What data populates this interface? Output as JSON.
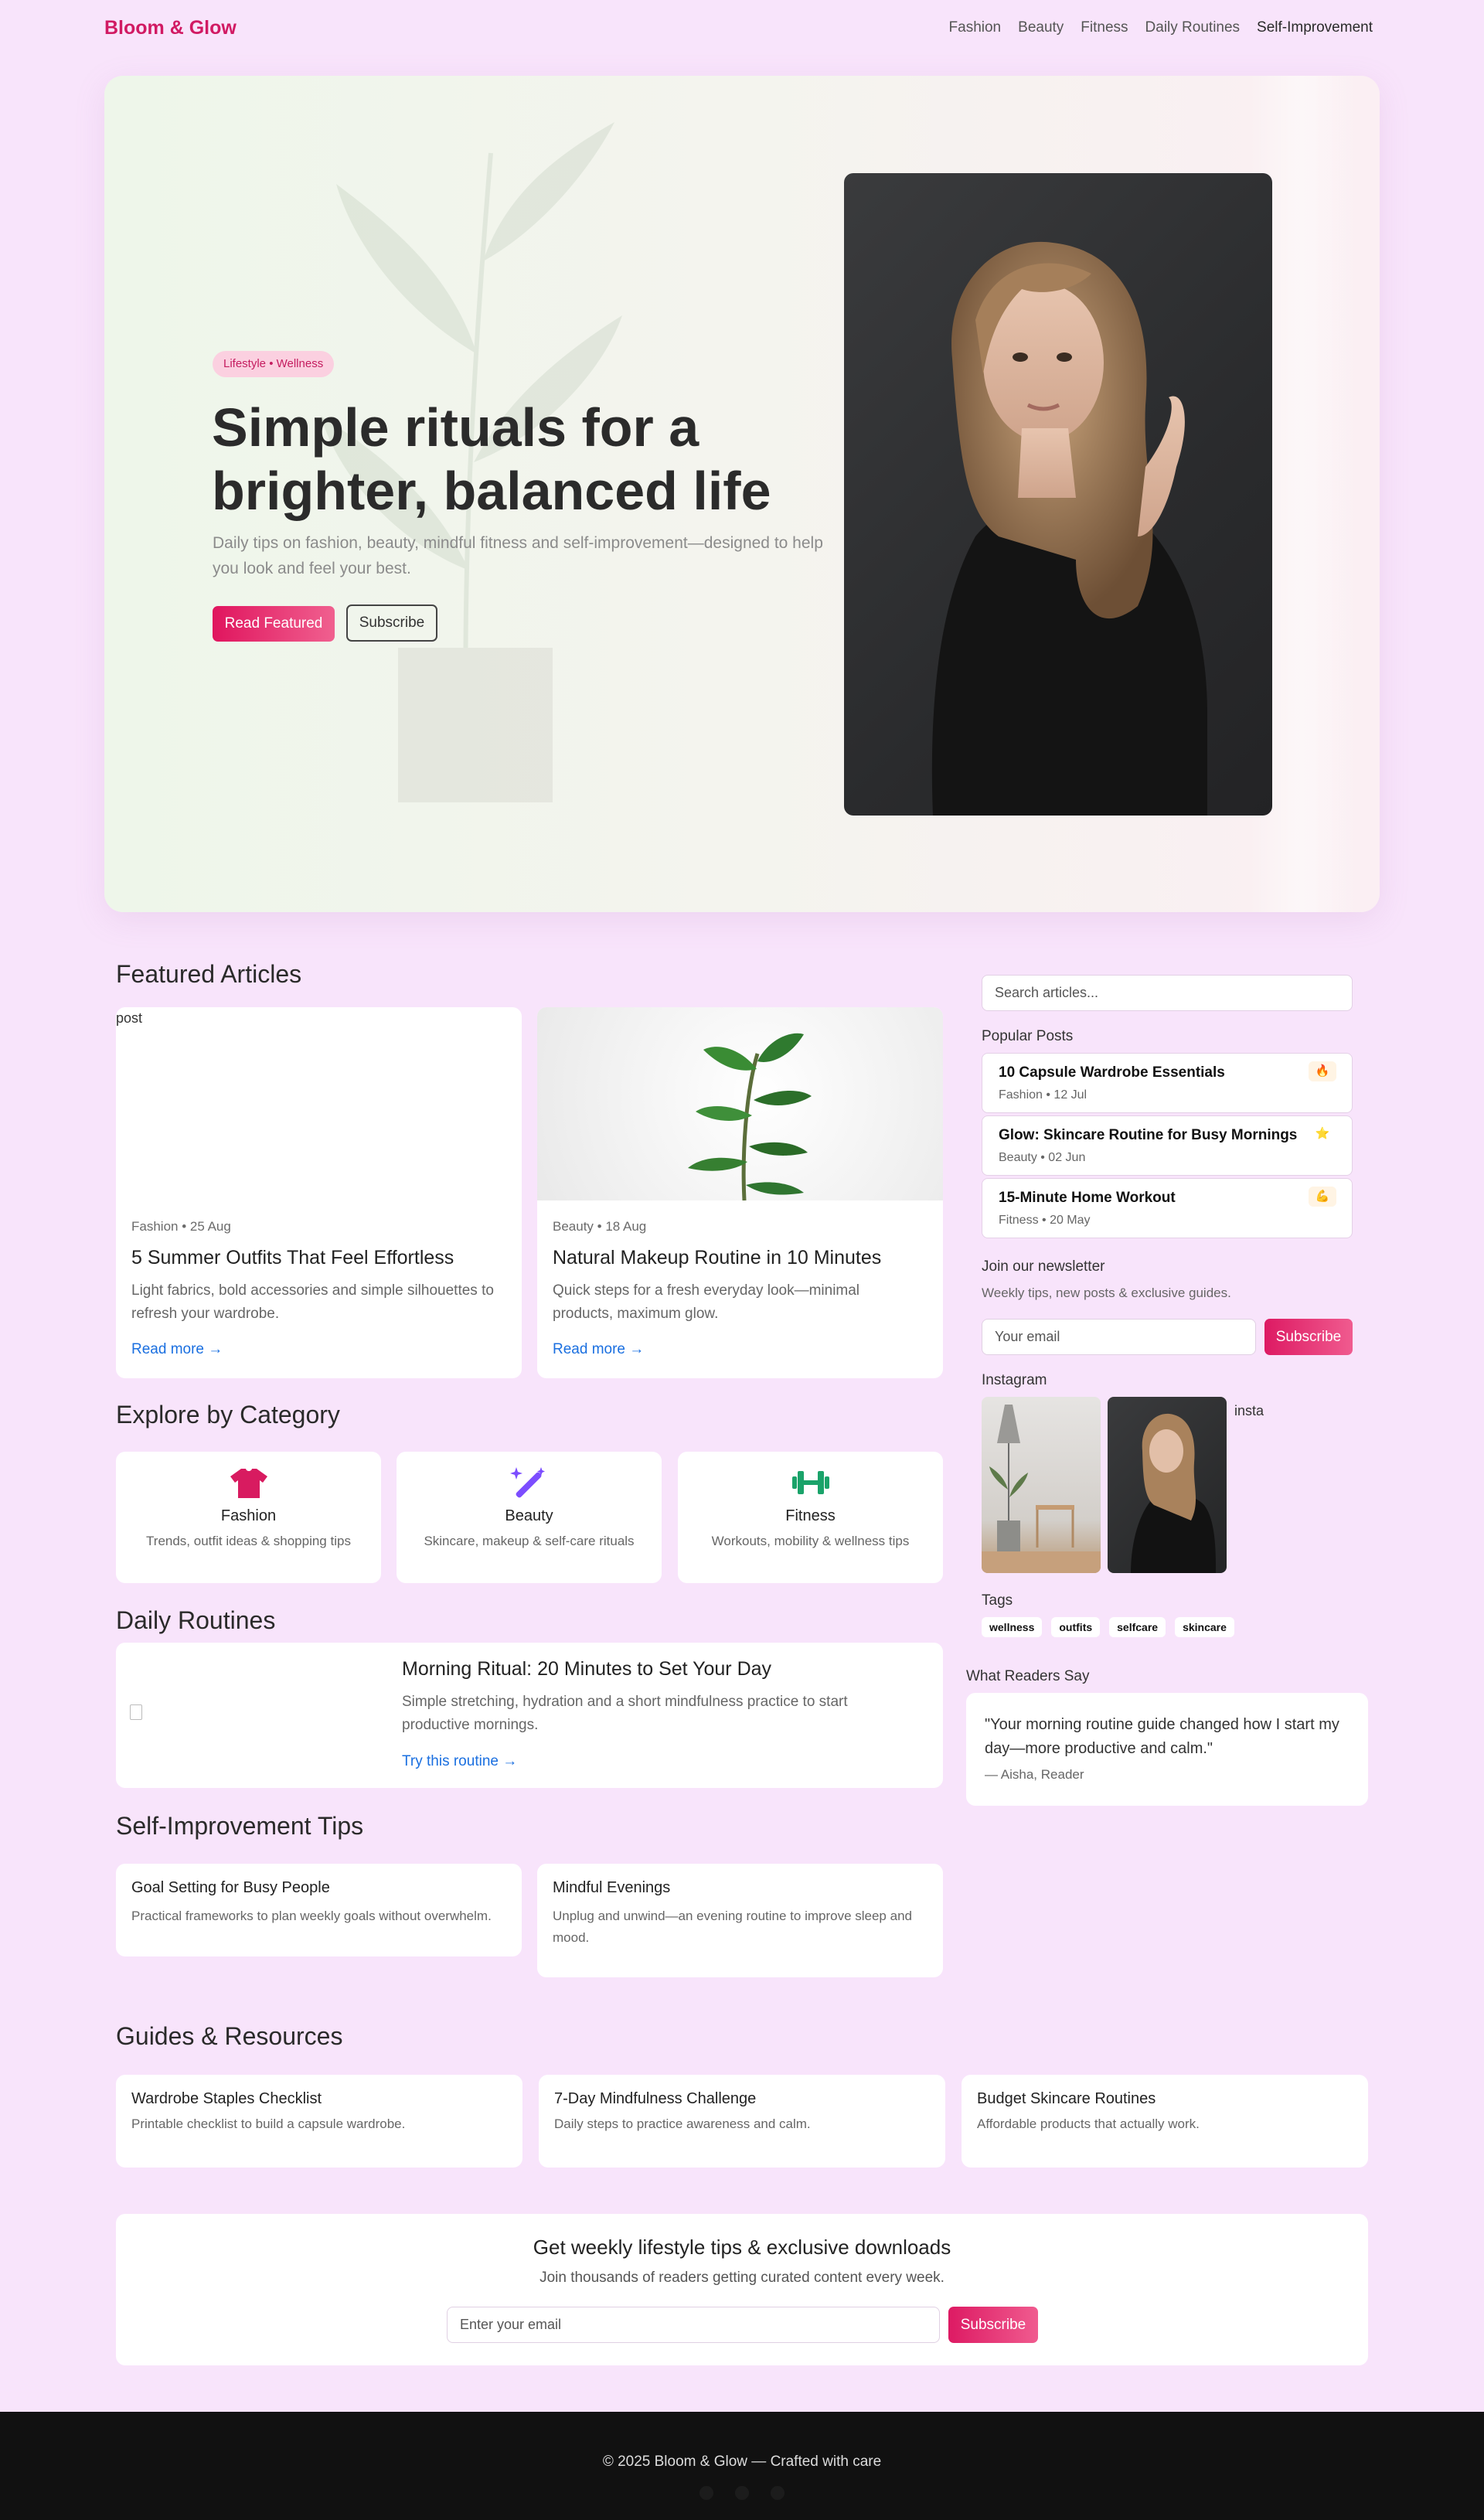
{
  "nav": {
    "brand": "Bloom & Glow",
    "links": [
      "Fashion",
      "Beauty",
      "Fitness",
      "Daily Routines",
      "Self-Improvement"
    ]
  },
  "hero": {
    "badge": "Lifestyle • Wellness",
    "title": "Simple rituals for a brighter, balanced life",
    "subtitle": "Daily tips on fashion, beauty, mindful fitness and self-improvement—designed to help you look and feel your best.",
    "primary_button": "Read Featured",
    "secondary_button": "Subscribe"
  },
  "featured": {
    "heading": "Featured Articles",
    "articles": [
      {
        "image_alt": "post",
        "meta": "Fashion • 25 Aug",
        "title": "5 Summer Outfits That Feel Effortless",
        "desc": "Light fabrics, bold accessories and simple silhouettes to refresh your wardrobe.",
        "link": "Read more →"
      },
      {
        "meta": "Beauty • 18 Aug",
        "title": "Natural Makeup Routine in 10 Minutes",
        "desc": "Quick steps for a fresh everyday look—minimal products, maximum glow.",
        "link": "Read more →"
      }
    ]
  },
  "categories": {
    "heading": "Explore by Category",
    "items": [
      {
        "name": "Fashion",
        "desc": "Trends, outfit ideas & shopping tips",
        "icon": "tshirt-icon",
        "color": "#d81b60"
      },
      {
        "name": "Beauty",
        "desc": "Skincare, makeup & self-care rituals",
        "icon": "magic-wand-icon",
        "color": "#7c4dff"
      },
      {
        "name": "Fitness",
        "desc": "Workouts, mobility & wellness tips",
        "icon": "dumbbell-icon",
        "color": "#1aa36a"
      }
    ]
  },
  "routines": {
    "heading": "Daily Routines",
    "title": "Morning Ritual: 20 Minutes to Set Your Day",
    "desc": "Simple stretching, hydration and a short mindfulness practice to start productive mornings.",
    "link": "Try this routine →"
  },
  "tips": {
    "heading": "Self-Improvement Tips",
    "items": [
      {
        "title": "Goal Setting for Busy People",
        "desc": "Practical frameworks to plan weekly goals without overwhelm."
      },
      {
        "title": "Mindful Evenings",
        "desc": "Unplug and unwind—an evening routine to improve sleep and mood."
      }
    ]
  },
  "sidebar": {
    "search_placeholder": "Search articles...",
    "popular_label": "Popular Posts",
    "popular": [
      {
        "title": "10 Capsule Wardrobe Essentials",
        "meta": "Fashion • 12 Jul",
        "icon": "🔥"
      },
      {
        "title": "Glow: Skincare Routine for Busy Mornings",
        "meta": "Beauty • 02 Jun",
        "icon": "⭐"
      },
      {
        "title": "15-Minute Home Workout",
        "meta": "Fitness • 20 May",
        "icon": "💪"
      }
    ],
    "newsletter_label": "Join our newsletter",
    "newsletter_sub": "Weekly tips, new posts & exclusive guides.",
    "email_placeholder": "Your email",
    "subscribe": "Subscribe",
    "instagram_label": "Instagram",
    "insta_alt": "insta",
    "tags_label": "Tags",
    "tags": [
      "wellness",
      "outfits",
      "selfcare",
      "skincare"
    ]
  },
  "testimonial": {
    "label": "What Readers Say",
    "quote": "\"Your morning routine guide changed how I start my day—more productive and calm.\"",
    "author": "— Aisha, Reader"
  },
  "guides": {
    "heading": "Guides & Resources",
    "items": [
      {
        "title": "Wardrobe Staples Checklist",
        "desc": "Printable checklist to build a capsule wardrobe."
      },
      {
        "title": "7-Day Mindfulness Challenge",
        "desc": "Daily steps to practice awareness and calm."
      },
      {
        "title": "Budget Skincare Routines",
        "desc": "Affordable products that actually work."
      }
    ]
  },
  "cta": {
    "title": "Get weekly lifestyle tips & exclusive downloads",
    "subtitle": "Join thousands of readers getting curated content every week.",
    "placeholder": "Enter your email",
    "button": "Subscribe"
  },
  "footer": {
    "text": "© 2025 Bloom & Glow — Crafted with care"
  }
}
